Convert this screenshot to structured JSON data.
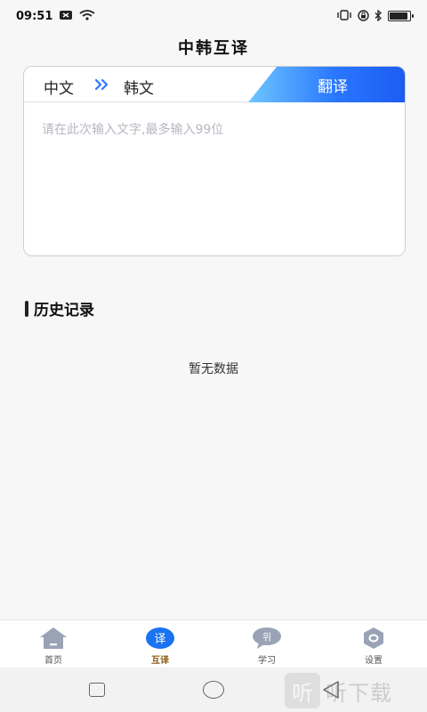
{
  "status": {
    "time": "09:51",
    "battery_level": 0.85
  },
  "page": {
    "title": "中韩互译"
  },
  "translator": {
    "source_lang": "中文",
    "target_lang": "韩文",
    "translate_label": "翻译",
    "input_placeholder": "请在此次输入文字,最多输入99位"
  },
  "history": {
    "title": "历史记录",
    "empty_text": "暂无数据"
  },
  "tabs": [
    {
      "label": "首页",
      "icon": "home-icon"
    },
    {
      "label": "互译",
      "icon": "translate-icon",
      "glyph": "译"
    },
    {
      "label": "学习",
      "icon": "study-icon",
      "glyph": "위"
    },
    {
      "label": "设置",
      "icon": "settings-icon"
    }
  ],
  "colors": {
    "accent": "#2a78ff",
    "active_tab": "#8a5a12",
    "inactive_icon": "#9aa3b5"
  },
  "watermark": {
    "glyph": "听",
    "text": "听下载"
  }
}
